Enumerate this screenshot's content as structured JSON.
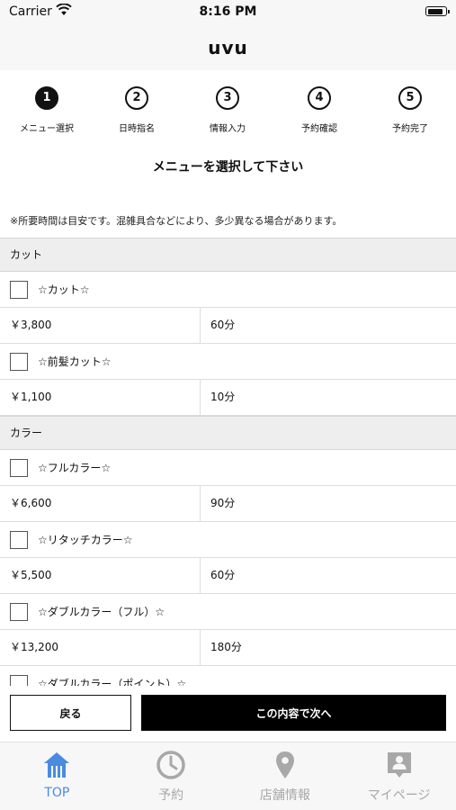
{
  "status": {
    "carrier": "Carrier",
    "time": "8:16 PM"
  },
  "app": {
    "title": "uvu"
  },
  "steps": [
    {
      "num": "1",
      "label": "メニュー選択",
      "active": true
    },
    {
      "num": "2",
      "label": "日時指名",
      "active": false
    },
    {
      "num": "3",
      "label": "情報入力",
      "active": false
    },
    {
      "num": "4",
      "label": "予約確認",
      "active": false
    },
    {
      "num": "5",
      "label": "予約完了",
      "active": false
    }
  ],
  "instruction": "メニューを選択して下さい",
  "note": "※所要時間は目安です。混雑具合などにより、多少異なる場合があります。",
  "categories": [
    {
      "name": "カット",
      "items": [
        {
          "name": "☆カット☆",
          "price": "￥3,800",
          "duration": "60分"
        },
        {
          "name": "☆前髪カット☆",
          "price": "￥1,100",
          "duration": "10分"
        }
      ]
    },
    {
      "name": "カラー",
      "items": [
        {
          "name": "☆フルカラー☆",
          "price": "￥6,600",
          "duration": "90分"
        },
        {
          "name": "☆リタッチカラー☆",
          "price": "￥5,500",
          "duration": "60分"
        },
        {
          "name": "☆ダブルカラー（フル）☆",
          "price": "￥13,200",
          "duration": "180分"
        },
        {
          "name": "☆ダブルカラー（ポイント）☆"
        }
      ]
    }
  ],
  "buttons": {
    "back": "戻る",
    "next": "この内容で次へ"
  },
  "tabs": [
    {
      "label": "TOP",
      "icon": "home-icon",
      "active": true
    },
    {
      "label": "予約",
      "icon": "clock-icon",
      "active": false
    },
    {
      "label": "店舗情報",
      "icon": "map-pin-icon",
      "active": false
    },
    {
      "label": "マイページ",
      "icon": "person-badge-icon",
      "active": false
    }
  ],
  "colors": {
    "accent": "#4a8be0",
    "inactive": "#a8a8a8",
    "primary": "#000000"
  }
}
